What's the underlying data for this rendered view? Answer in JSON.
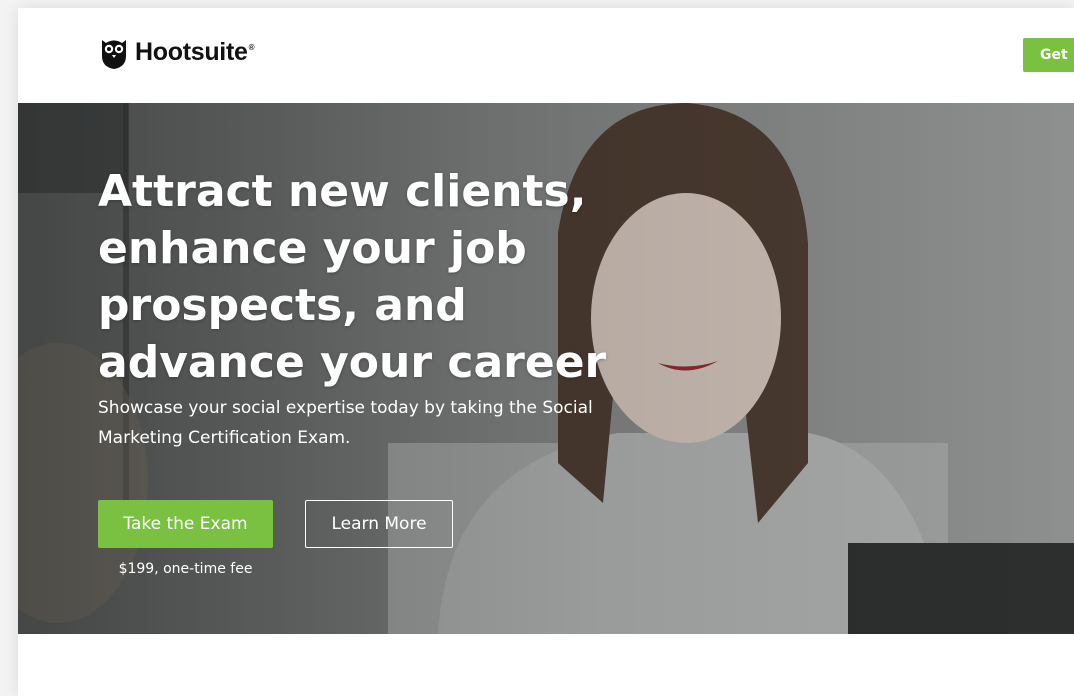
{
  "header": {
    "logo_text": "Hootsuite",
    "logo_mark": "®",
    "logo_icon": "owl-icon",
    "cta_label": "Get"
  },
  "hero": {
    "headline": "Attract new clients, enhance your job prospects, and advance your career",
    "subheadline": "Showcase your social expertise today by taking the Social Marketing Certification Exam.",
    "primary_button": "Take the Exam",
    "secondary_button": "Learn More",
    "price_note": "$199, one-time fee"
  },
  "colors": {
    "accent_green": "#7ac142",
    "hero_overlay": "#6e716f",
    "text_dark": "#111111",
    "text_light": "#ffffff"
  }
}
